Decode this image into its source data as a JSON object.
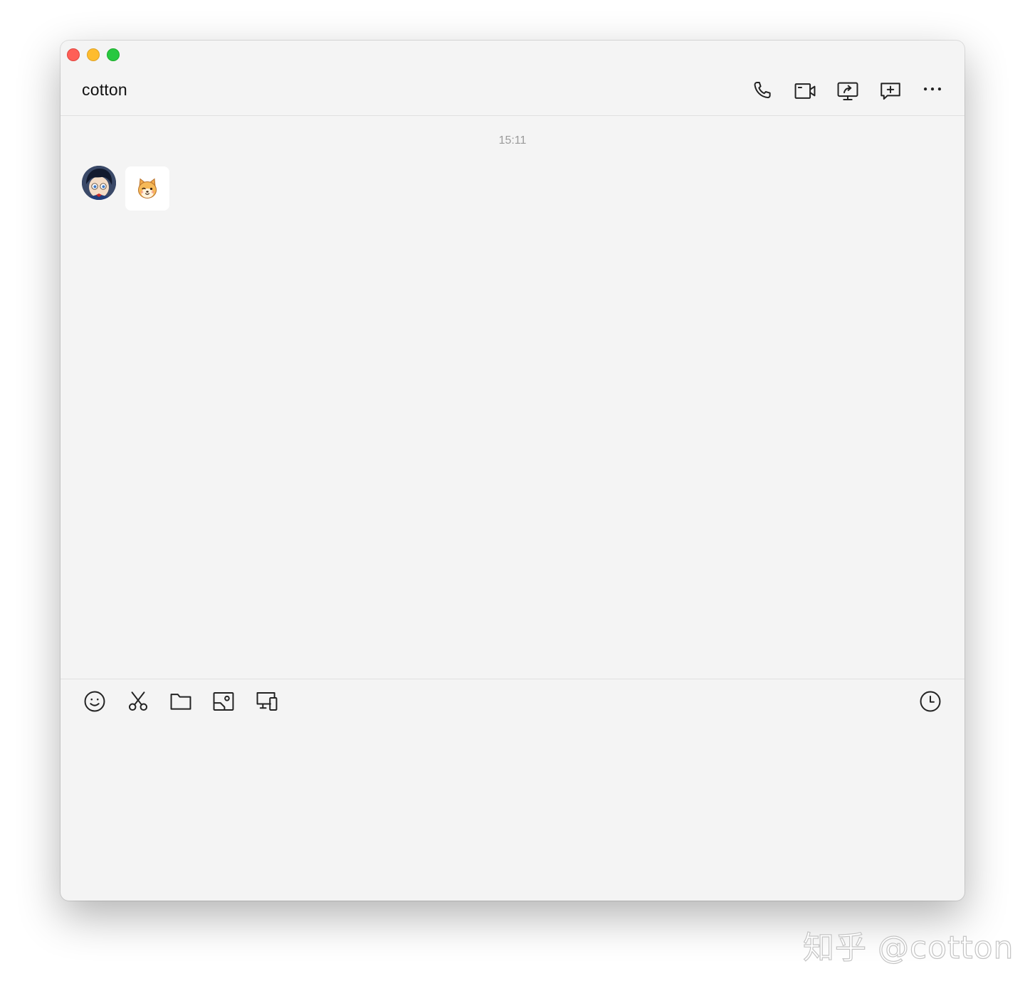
{
  "window": {
    "title": "cotton"
  },
  "header": {
    "actions": [
      {
        "icon": "phone-icon"
      },
      {
        "icon": "video-camera-icon"
      },
      {
        "icon": "screen-share-icon"
      },
      {
        "icon": "add-comment-icon"
      },
      {
        "icon": "more-icon"
      }
    ]
  },
  "chat": {
    "timestamp": "15:11",
    "messages": [
      {
        "sender_avatar": "avatar",
        "content_type": "sticker",
        "sticker": "dog-face-sticker"
      }
    ]
  },
  "toolbar": {
    "tools": [
      {
        "icon": "emoji-icon"
      },
      {
        "icon": "scissors-icon"
      },
      {
        "icon": "folder-icon"
      },
      {
        "icon": "image-screenshot-icon"
      },
      {
        "icon": "devices-icon"
      }
    ],
    "history_icon": "clock-icon"
  },
  "input": {
    "value": "",
    "placeholder": ""
  },
  "watermark": {
    "text": "知乎 @cotton"
  }
}
